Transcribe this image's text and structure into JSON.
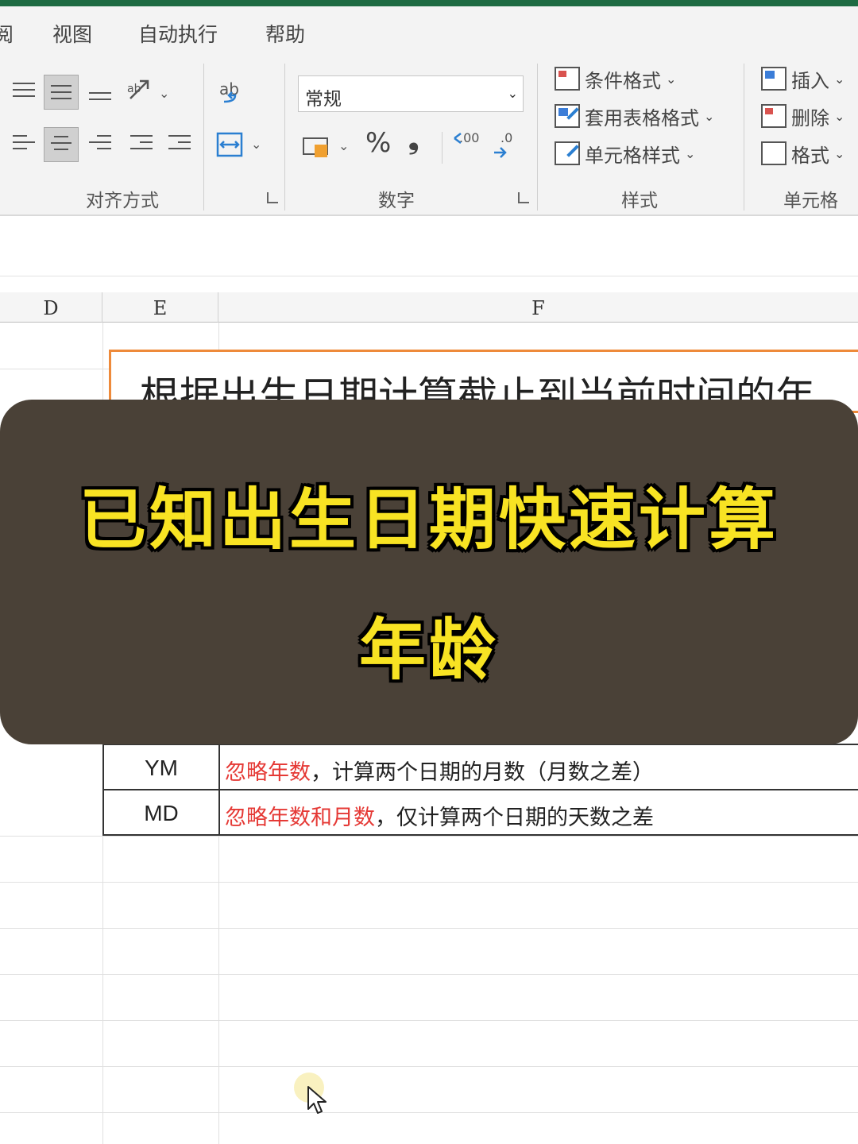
{
  "menu": {
    "partial_left": "阅",
    "items": [
      "视图",
      "自动执行",
      "帮助"
    ]
  },
  "ribbon": {
    "alignment": {
      "label": "对齐方式",
      "wrap_icon_text": "ab"
    },
    "number": {
      "label": "数字",
      "format_value": "常规",
      "percent_symbol": "%",
      "comma_symbol": "❟",
      "increase_decimal": ".00",
      "decrease_decimal": ".0"
    },
    "styles": {
      "label": "样式",
      "conditional_format": "条件格式",
      "format_as_table": "套用表格格式",
      "cell_styles": "单元格样式"
    },
    "cells": {
      "label": "单元格",
      "insert": "插入",
      "delete": "删除",
      "format": "格式"
    }
  },
  "sheet": {
    "columns": [
      "D",
      "E",
      "F"
    ],
    "hero_text": "根据出生日期计算截止到当前时间的年",
    "rows": [
      {
        "key": "YM",
        "desc_red": "忽略年数",
        "desc_rest": "，计算两个日期的月数（月数之差）"
      },
      {
        "key": "MD",
        "desc_red": "忽略年数和月数",
        "desc_rest": "，仅计算两个日期的天数之差"
      }
    ]
  },
  "overlay": {
    "line1": "已知出生日期快速计算",
    "line2": "年龄"
  },
  "colors": {
    "accent_green": "#1e6b42",
    "highlight_orange": "#ee8a3a",
    "overlay_bg": "#4a4137",
    "title_yellow": "#f8e323",
    "note_red": "#e53935"
  }
}
